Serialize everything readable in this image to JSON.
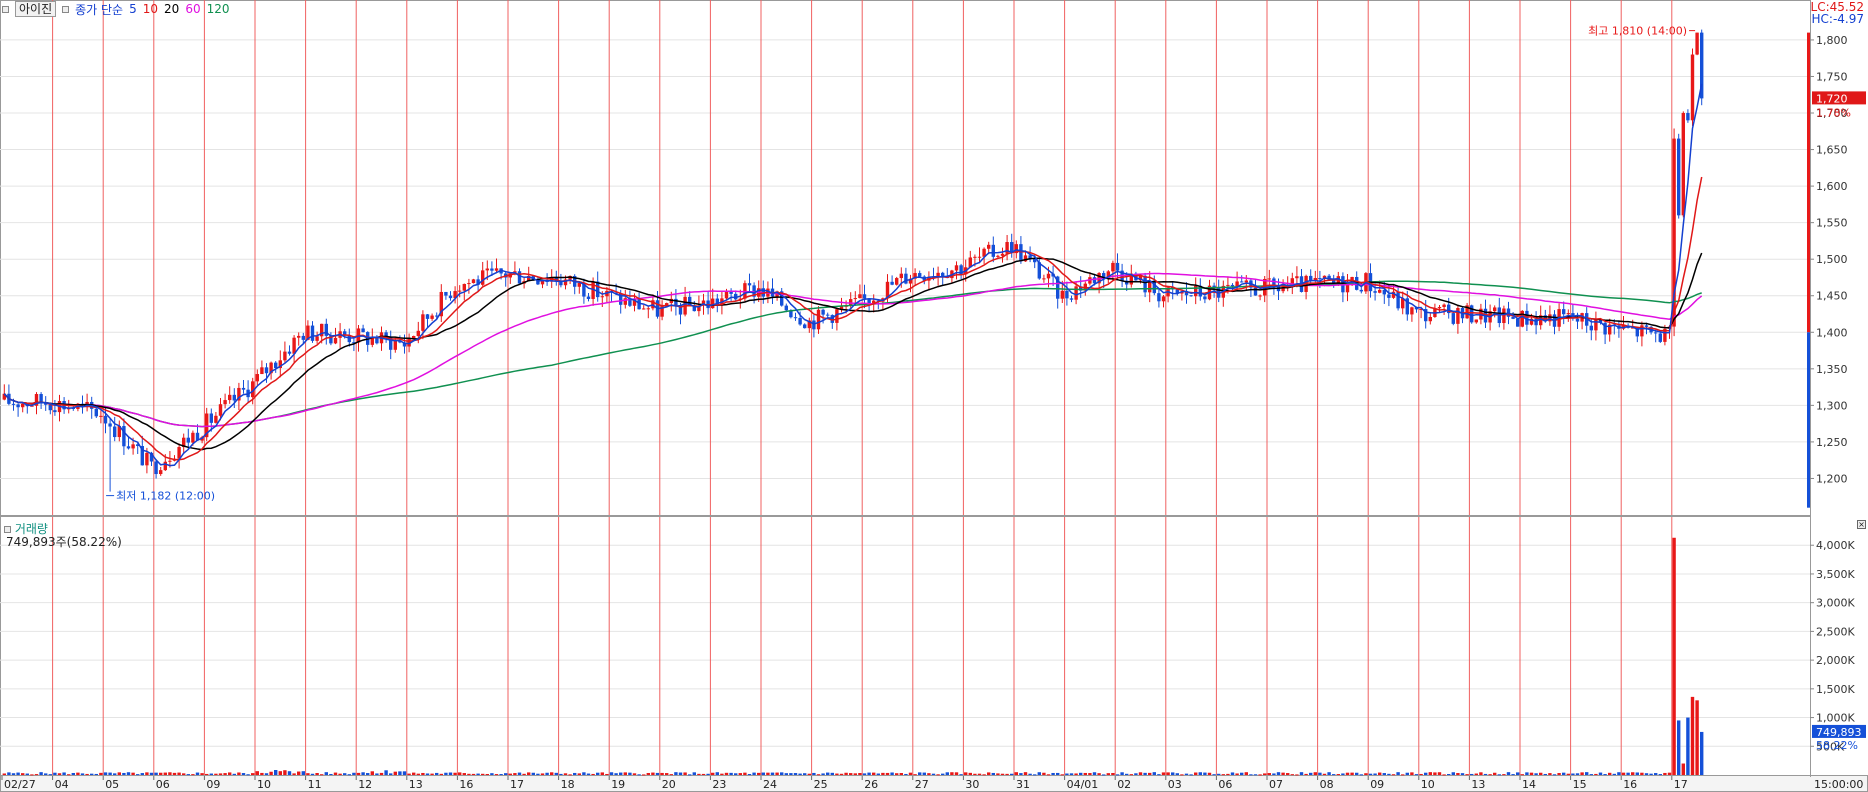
{
  "toolbar": {
    "tab_label": "아이진",
    "ma_type": "종가 단순",
    "ma_periods": [
      "5",
      "10",
      "20",
      "60",
      "120"
    ]
  },
  "price_panel": {
    "lc_label": "LC:45.52",
    "hc_label": "HC:-4.97",
    "high_annotation": "최고 1,810 (14:00)",
    "low_annotation": "최저 1,182 (12:00)",
    "current_price_label": "1,720",
    "current_change_label": "1.78%"
  },
  "volume_panel": {
    "title": "거래량",
    "summary": "749,893주(58.22%)",
    "current_volume_label": "749,893",
    "current_ratio_label": "58.22%"
  },
  "time_axis": {
    "end_time_label": "15:00:00"
  },
  "colors": {
    "up": "#e81818",
    "down": "#1450d8",
    "ma5": "#1440d0",
    "ma10": "#e01818",
    "ma20": "#000000",
    "ma60": "#e010e0",
    "ma120": "#109050",
    "divider": "#f06060",
    "grid": "#e4e4e4"
  },
  "chart_data": [
    {
      "type": "candlestick",
      "title": "",
      "x": [
        "02/27",
        "04",
        "05",
        "06",
        "09",
        "10",
        "11",
        "12",
        "13",
        "16",
        "17",
        "18",
        "19",
        "20",
        "23",
        "24",
        "25",
        "26",
        "27",
        "30",
        "31",
        "04/01",
        "02",
        "03",
        "06",
        "07",
        "08",
        "09",
        "10",
        "13",
        "14",
        "15",
        "16",
        "17"
      ],
      "ylim": [
        1150,
        1830
      ],
      "yticks": [
        1200,
        1250,
        1300,
        1350,
        1400,
        1450,
        1500,
        1550,
        1600,
        1650,
        1700,
        1750,
        1800
      ],
      "grid": true,
      "daily_close": [
        1305,
        1290,
        1215,
        1270,
        1330,
        1400,
        1395,
        1385,
        1465,
        1480,
        1475,
        1450,
        1430,
        1440,
        1460,
        1415,
        1440,
        1480,
        1490,
        1520,
        1450,
        1490,
        1450,
        1455,
        1460,
        1465,
        1470,
        1425,
        1425,
        1420,
        1420,
        1405,
        1395,
        1720
      ],
      "series_labels": [
        "5",
        "10",
        "20",
        "60",
        "120"
      ],
      "annotations": [
        {
          "text": "최고 1,810 (14:00)",
          "value": 1810
        },
        {
          "text": "최저 1,182 (12:00)",
          "value": 1182
        }
      ],
      "last_price": 1720,
      "last_change_pct": 1.78
    },
    {
      "type": "bar",
      "title": "거래량",
      "x": [
        "02/27",
        "04",
        "05",
        "06",
        "09",
        "10",
        "11",
        "12",
        "13",
        "16",
        "17",
        "18",
        "19",
        "20",
        "23",
        "24",
        "25",
        "26",
        "27",
        "30",
        "31",
        "04/01",
        "02",
        "03",
        "06",
        "07",
        "08",
        "09",
        "10",
        "13",
        "14",
        "15",
        "16",
        "17"
      ],
      "ylim": [
        0,
        4300000
      ],
      "yticks_labels": [
        "500K",
        "1,000K",
        "1,500K",
        "2,000K",
        "2,500K",
        "3,000K",
        "3,500K",
        "4,000K"
      ],
      "yticks": [
        500000,
        1000000,
        1500000,
        2000000,
        2500000,
        3000000,
        3500000,
        4000000
      ],
      "last_day_bars": [
        4130000,
        950000,
        200000,
        1000000,
        1360000,
        1300000,
        749893
      ],
      "last_value": 749893,
      "last_ratio_pct": 58.22
    }
  ]
}
